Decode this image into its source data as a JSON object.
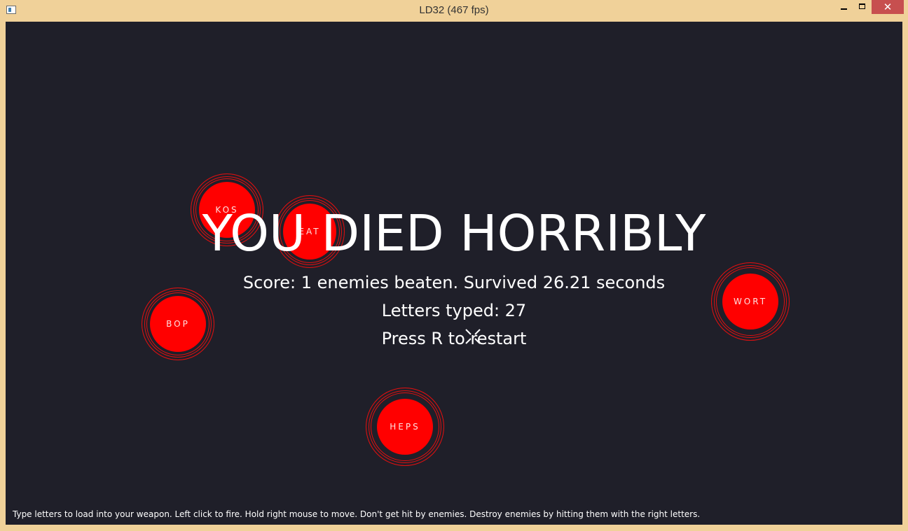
{
  "window": {
    "title": "LD32  (467 fps)",
    "close_glyph": "✕"
  },
  "game": {
    "headline": "YOU DIED HORRIBLY",
    "score_text": "Score: 1 enemies beaten. Survived 26.21 seconds",
    "letters_text": "Letters typed: 27",
    "restart_text": "Press R to restart",
    "instructions": "Type letters to load into your weapon. Left click to fire. Hold right mouse to move. Don't get hit by enemies. Destroy enemies by hitting them with the right letters.",
    "enemies": [
      {
        "word": "KOS"
      },
      {
        "word": "EAT"
      },
      {
        "word": "BOP"
      },
      {
        "word": "WORT"
      },
      {
        "word": "HEPS"
      }
    ],
    "colors": {
      "background": "#1f1f29",
      "enemy": "#ff0000",
      "text": "#ffffff",
      "frame": "#f0d199"
    }
  }
}
